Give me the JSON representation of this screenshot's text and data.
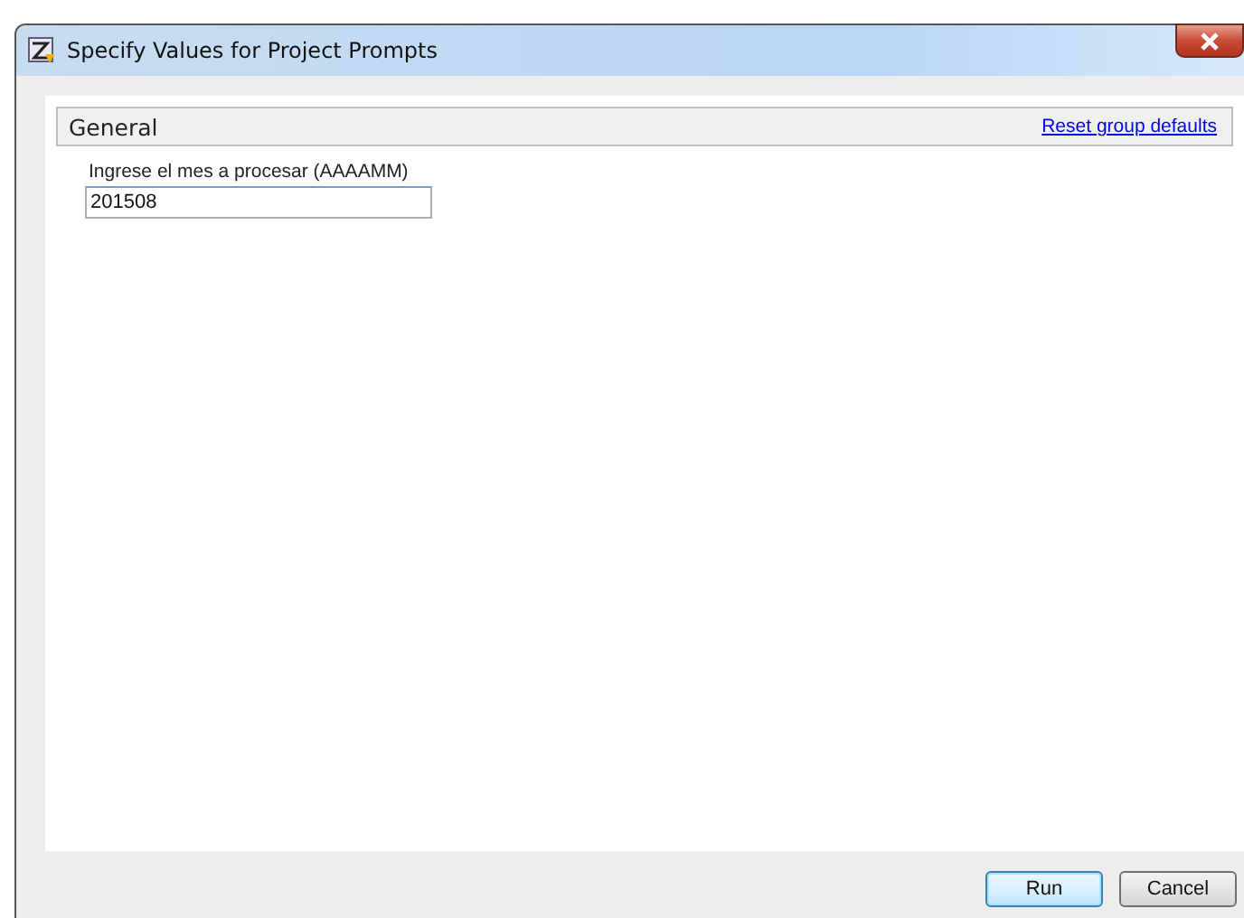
{
  "window": {
    "title": "Specify Values for Project Prompts"
  },
  "group": {
    "title": "General",
    "reset_link": "Reset group defaults"
  },
  "prompt": {
    "label": "Ingrese el mes a procesar (AAAAMM)",
    "value": "201508"
  },
  "buttons": [
    {
      "label": "Run",
      "kind": "default"
    },
    {
      "label": "Cancel",
      "kind": "normal"
    }
  ]
}
